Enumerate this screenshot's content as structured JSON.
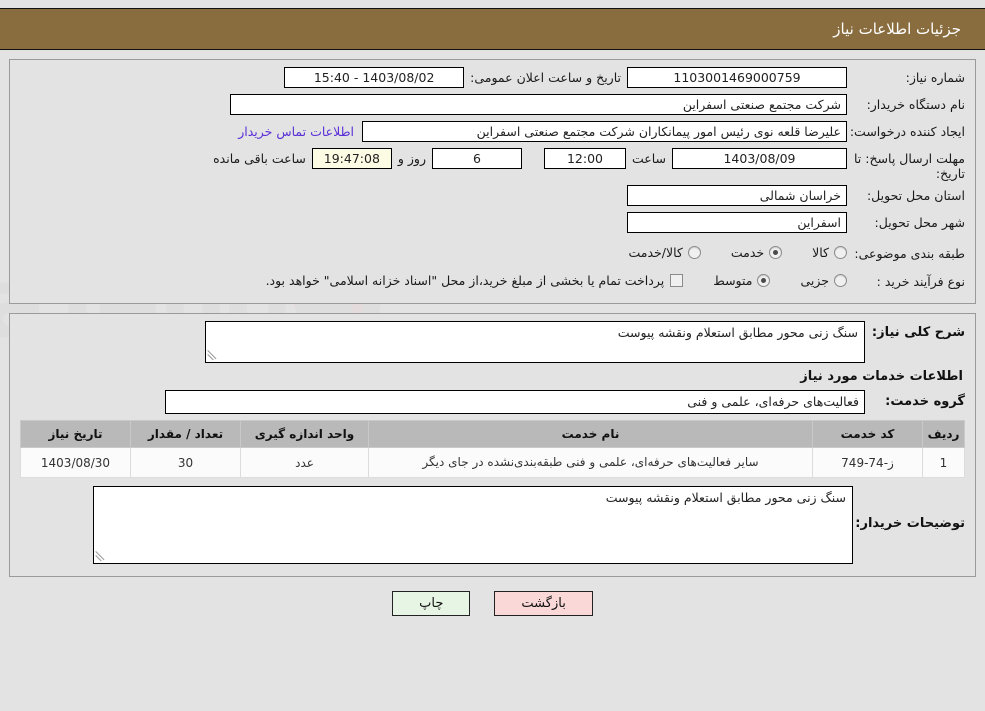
{
  "header": {
    "title": "جزئیات اطلاعات نیاز"
  },
  "summary": {
    "need_number_label": "شماره نیاز:",
    "need_number_value": "1103001469000759",
    "announce_datetime_label": "تاریخ و ساعت اعلان عمومی:",
    "announce_datetime_value": "1403/08/02 - 15:40",
    "buyer_org_label": "نام دستگاه خریدار:",
    "buyer_org_value": "شرکت مجتمع صنعتی اسفراین",
    "requester_label": "ایجاد کننده درخواست:",
    "requester_value": "علیرضا قلعه نوی رئیس امور پیمانکاران شرکت مجتمع صنعتی اسفراین",
    "contact_link": "اطلاعات تماس خریدار",
    "deadline_label": "مهلت ارسال پاسخ: تا تاریخ:",
    "deadline_date": "1403/08/09",
    "deadline_hour_label": "ساعت",
    "deadline_hour": "12:00",
    "days_remaining": "6",
    "days_label": "روز و",
    "countdown": "19:47:08",
    "countdown_label": "ساعت باقی مانده",
    "province_label": "استان محل تحویل:",
    "province_value": "خراسان شمالی",
    "city_label": "شهر محل تحویل:",
    "city_value": "اسفراین",
    "category_label": "طبقه بندی موضوعی:",
    "category_options": [
      {
        "label": "کالا",
        "selected": false
      },
      {
        "label": "خدمت",
        "selected": true
      },
      {
        "label": "کالا/خدمت",
        "selected": false
      }
    ],
    "process_label": "نوع فرآیند خرید :",
    "process_options": [
      {
        "label": "جزیی",
        "selected": false
      },
      {
        "label": "متوسط",
        "selected": true
      }
    ],
    "treasury_note": "پرداخت تمام یا بخشی از مبلغ خرید،از محل \"اسناد خزانه اسلامی\" خواهد بود."
  },
  "description": {
    "general_label": "شرح کلی نیاز:",
    "general_value": "سنگ زنی محور مطابق استعلام ونقشه پیوست",
    "services_section_title": "اطلاعات خدمات مورد نیاز",
    "service_group_label": "گروه خدمت:",
    "service_group_value": "فعالیت‌های حرفه‌ای، علمی و فنی"
  },
  "items_table": {
    "columns": [
      "ردیف",
      "کد خدمت",
      "نام خدمت",
      "واحد اندازه گیری",
      "تعداد / مقدار",
      "تاریخ نیاز"
    ],
    "rows": [
      {
        "row_no": "1",
        "service_code": "ز-74-749",
        "service_name": "سایر فعالیت‌های حرفه‌ای، علمی و فنی طبقه‌بندی‌نشده در جای دیگر",
        "unit": "عدد",
        "quantity": "30",
        "need_date": "1403/08/30"
      }
    ]
  },
  "buyer_comments": {
    "label": "توضیحات خریدار:",
    "value": "سنگ زنی محور مطابق استعلام ونقشه پیوست"
  },
  "footer": {
    "print_label": "چاپ",
    "back_label": "بازگشت"
  },
  "colors": {
    "titlebar_bg": "#8a6d3f",
    "page_bg": "#e3e3e3",
    "link": "#5a2fd8",
    "countdown_bg": "#fcfbe3",
    "table_header_bg": "#b9b9b9",
    "print_btn_bg": "#e6f5e4",
    "back_btn_bg": "#fbd8d8"
  }
}
